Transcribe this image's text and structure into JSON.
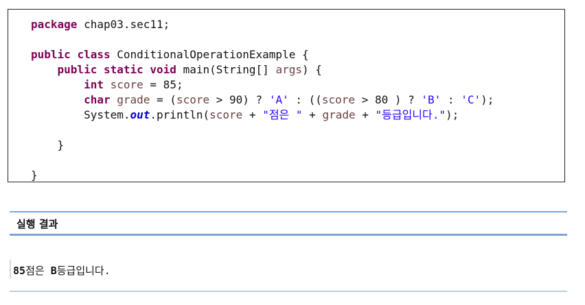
{
  "code": {
    "line1": {
      "kw_package": "package",
      "rest": " chap03.sec11;"
    },
    "line3": {
      "kw_public": "public",
      "kw_class": "class",
      "rest": " ConditionalOperationExample {"
    },
    "line4": {
      "kw_public": "public",
      "kw_static": "static",
      "kw_void": "void",
      "rest_a": " main(String[] ",
      "var_args": "args",
      "rest_b": ") {"
    },
    "line5": {
      "kw_int": "int",
      "var_score": "score",
      "rest": " = 85;"
    },
    "line6": {
      "kw_char": "char",
      "var_grade": "grade",
      "p1": " = (",
      "var_score1": "score",
      "p2": " > 90) ? ",
      "str_a": "'A'",
      "p3": " : ((",
      "var_score2": "score",
      "p4": " > 80 ) ? ",
      "str_b": "'B'",
      "p5": " : ",
      "str_c": "'C'",
      "p6": ");"
    },
    "line7": {
      "p1": "System.",
      "fld_out": "out",
      "p2": ".println(",
      "var_score": "score",
      "p3": " + ",
      "str1": "\"점은 \"",
      "p4": " + ",
      "var_grade": "grade",
      "p5": " + ",
      "str2": "\"등급입니다.\"",
      "p6": ");"
    },
    "line9": {
      "brace": "}"
    },
    "line11": {
      "brace": "}"
    }
  },
  "result": {
    "title": "실행 결과",
    "output_num": "85",
    "output_mid": "점은 ",
    "output_grade": "B",
    "output_end": "등급입니다."
  }
}
